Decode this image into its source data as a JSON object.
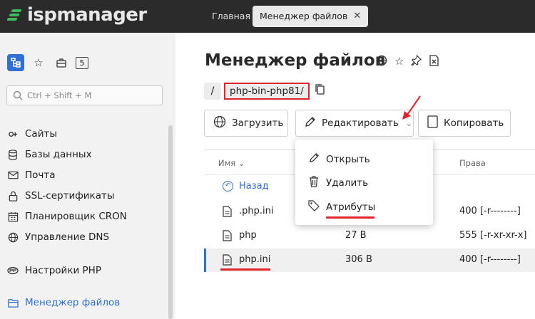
{
  "app": {
    "logo_text": "ispmanager",
    "brand_color": "#3fb95b"
  },
  "tabs": {
    "home": "Главная",
    "active": "Менеджер файлов",
    "close_glyph": "✕"
  },
  "sidebar": {
    "counter": "5",
    "search_placeholder": "Ctrl + Shift + M",
    "items": [
      {
        "label": "Сайты",
        "icon": "sites-icon"
      },
      {
        "label": "Базы данных",
        "icon": "database-icon"
      },
      {
        "label": "Почта",
        "icon": "mail-icon"
      },
      {
        "label": "SSL-сертификаты",
        "icon": "lock-icon"
      },
      {
        "label": "Планировщик CRON",
        "icon": "calendar-icon"
      },
      {
        "label": "Управление DNS",
        "icon": "globe-icon"
      },
      {
        "label": "Настройки PHP",
        "icon": "php-icon"
      },
      {
        "label": "Менеджер файлов",
        "icon": "files-icon"
      }
    ]
  },
  "page": {
    "title": "Менеджер файлов",
    "breadcrumb_root": "/",
    "breadcrumb_path": "php-bin-php81/"
  },
  "toolbar": {
    "upload": "Загрузить",
    "edit": "Редактировать",
    "copy": "Копировать"
  },
  "table": {
    "columns": {
      "name": "Имя",
      "perms": "Права"
    },
    "back": "Назад",
    "rows": [
      {
        "name": ".php.ini",
        "size": "",
        "perms": "400 [-r--------]"
      },
      {
        "name": "php",
        "size": "27 B",
        "perms": "555 [-r-xr-xr-x]"
      },
      {
        "name": "php.ini",
        "size": "306 B",
        "perms": "400 [-r--------]"
      }
    ]
  },
  "dropdown": {
    "open": "Открыть",
    "delete": "Удалить",
    "attributes": "Атрибуты"
  },
  "colors": {
    "accent": "#2f6fd6",
    "highlight": "#e0242c",
    "topbar": "#2b2b2b"
  }
}
